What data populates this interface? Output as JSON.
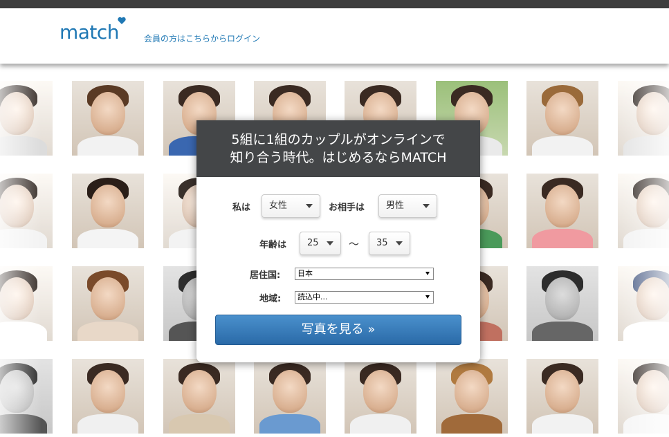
{
  "header": {
    "logo_text": "match",
    "login_link": "会員の方はこちらからログイン"
  },
  "panel": {
    "headline_line1": "5組に1組のカップルがオンラインで",
    "headline_line2": "知り合う時代。はじめるならMATCH",
    "i_am_label": "私は",
    "i_am_value": "女性",
    "seeking_label": "お相手は",
    "seeking_value": "男性",
    "age_label": "年齢は",
    "age_min": "25",
    "age_sep": "〜",
    "age_max": "35",
    "country_label": "居住国:",
    "country_value": "日本",
    "region_label": "地域:",
    "region_value": "読込中...",
    "cta_label": "写真を見る »"
  },
  "colors": {
    "brand_blue": "#1f78b4",
    "panel_header": "#444648",
    "cta_blue": "#2a6aa8"
  }
}
